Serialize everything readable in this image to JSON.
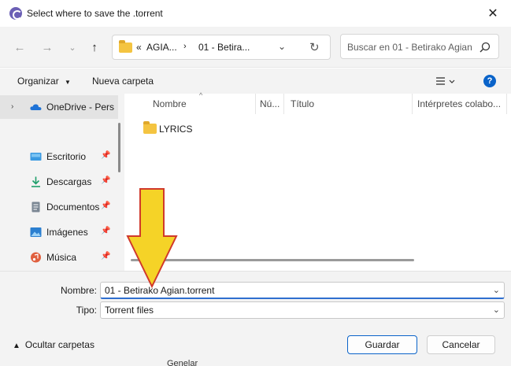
{
  "window": {
    "title": "Select where to save the .torrent"
  },
  "nav": {
    "breadcrumb": [
      "AGIA...",
      "01 - Betira..."
    ],
    "breadcrumb_prefix": "«",
    "search_placeholder": "Buscar en 01 - Betirako Agian"
  },
  "toolbar": {
    "organize_label": "Organizar",
    "new_folder_label": "Nueva carpeta"
  },
  "sidebar": {
    "items": [
      {
        "label": "OneDrive - Perso",
        "icon": "cloud-icon",
        "expandable": true,
        "selected": true
      },
      {
        "label": "Escritorio",
        "icon": "desktop-icon",
        "pinned": true
      },
      {
        "label": "Descargas",
        "icon": "download-icon",
        "pinned": true
      },
      {
        "label": "Documentos",
        "icon": "document-icon",
        "pinned": true
      },
      {
        "label": "Imágenes",
        "icon": "image-icon",
        "pinned": true
      },
      {
        "label": "Música",
        "icon": "music-icon",
        "pinned": true
      }
    ]
  },
  "file_list": {
    "columns": [
      "Nombre",
      "Nú...",
      "Título",
      "Intérpretes colabo..."
    ],
    "items": [
      {
        "name": "LYRICS",
        "type": "folder"
      }
    ]
  },
  "save": {
    "filename_label": "Nombre:",
    "filename_value": "01 - Betirako Agian.torrent",
    "type_label": "Tipo:",
    "type_value": "Torrent files",
    "hide_folders_label": "Ocultar carpetas",
    "save_label": "Guardar",
    "cancel_label": "Cancelar"
  },
  "background_peek": "Genelar",
  "colors": {
    "accent": "#0a63c9",
    "annotation_arrow": "#f5d327",
    "annotation_outline": "#d0392b",
    "folder": "#f4c441"
  }
}
